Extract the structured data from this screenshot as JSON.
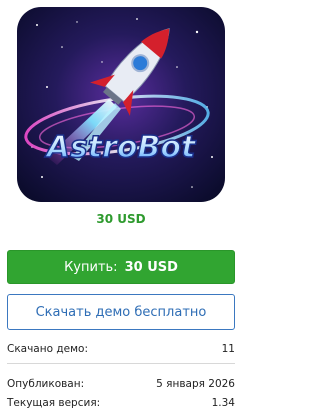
{
  "product": {
    "logo_text": "AstroBot",
    "price": "30 USD"
  },
  "actions": {
    "buy_label": "Купить:",
    "buy_amount": "30 USD",
    "demo_label": "Скачать демо бесплатно"
  },
  "stats": {
    "downloads_label": "Скачано демо:",
    "downloads_value": "11",
    "published_label": "Опубликован:",
    "published_value": "5 января 2026",
    "version_label": "Текущая версия:",
    "version_value": "1.34"
  },
  "colors": {
    "price": "#2e9a2e",
    "buy_button": "#31a531",
    "demo_border": "#3b78c0"
  }
}
